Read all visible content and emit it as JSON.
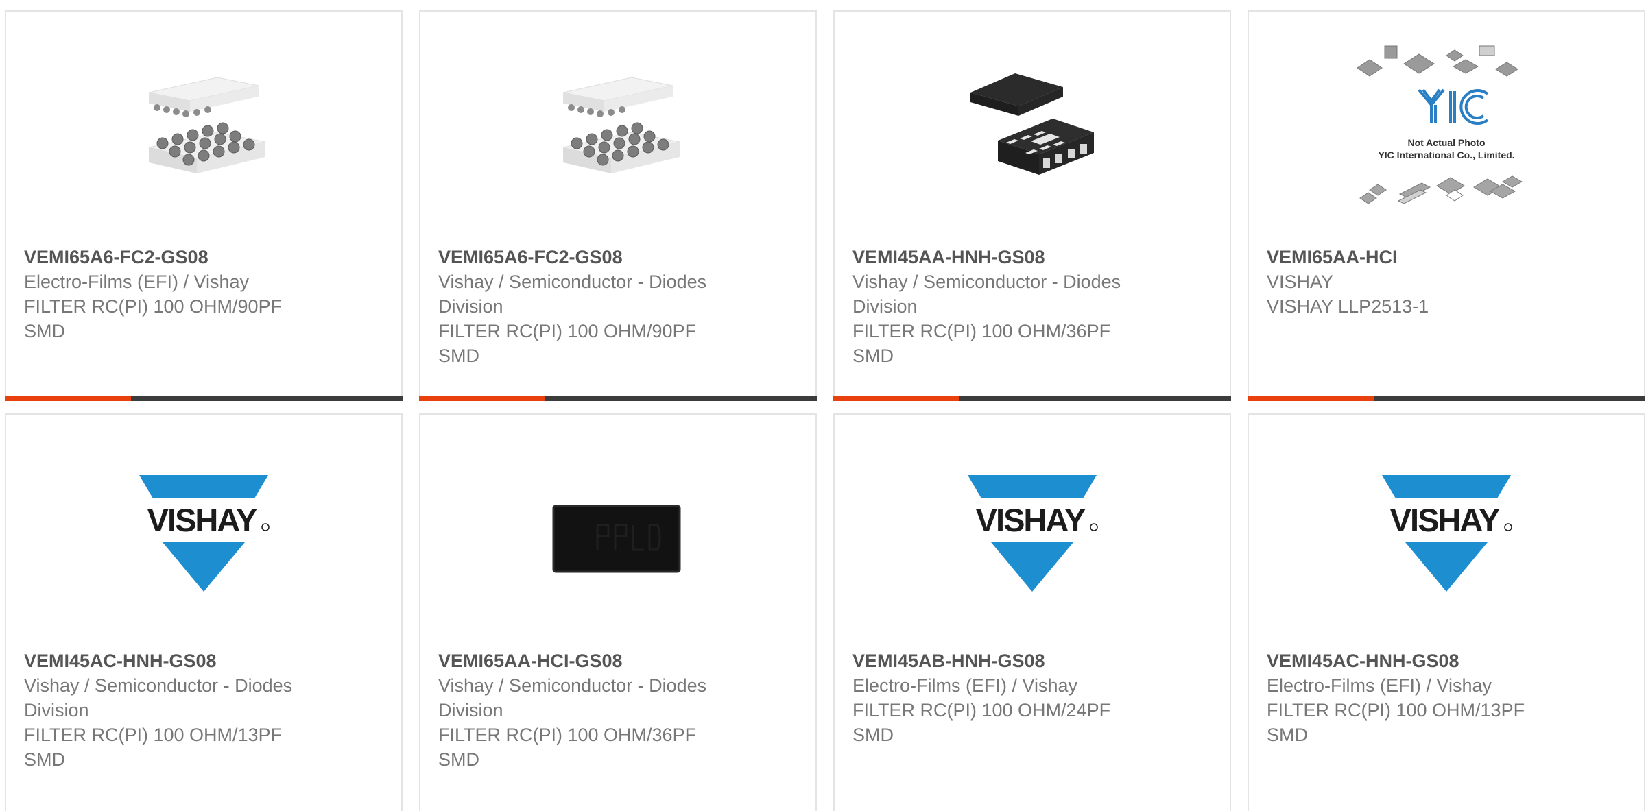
{
  "products": [
    {
      "part_number": "VEMI65A6-FC2-GS08",
      "lines": [
        "Electro-Films (EFI) / Vishay",
        "FILTER RC(PI) 100 OHM/90PF",
        "SMD"
      ],
      "image": "bga-package-icon",
      "show_bar": true
    },
    {
      "part_number": "VEMI65A6-FC2-GS08",
      "lines": [
        "Vishay / Semiconductor - Diodes",
        "Division",
        "FILTER RC(PI) 100 OHM/90PF",
        "SMD"
      ],
      "image": "bga-package-icon",
      "show_bar": true
    },
    {
      "part_number": "VEMI45AA-HNH-GS08",
      "lines": [
        "Vishay / Semiconductor - Diodes",
        "Division",
        "FILTER RC(PI) 100 OHM/36PF",
        "SMD"
      ],
      "image": "dfn-package-icon",
      "show_bar": true
    },
    {
      "part_number": "VEMI65AA-HCI",
      "lines": [
        "VISHAY",
        "VISHAY LLP2513-1"
      ],
      "image": "not-actual-photo",
      "show_bar": true
    },
    {
      "part_number": "VEMI45AC-HNH-GS08",
      "lines": [
        "Vishay / Semiconductor - Diodes",
        "Division",
        "FILTER RC(PI) 100 OHM/13PF",
        "SMD"
      ],
      "image": "vishay-logo",
      "show_bar": false
    },
    {
      "part_number": "VEMI65AA-HCI-GS08",
      "lines": [
        "Vishay / Semiconductor - Diodes",
        "Division",
        "FILTER RC(PI) 100 OHM/36PF",
        "SMD"
      ],
      "image": "chip-photo",
      "show_bar": false
    },
    {
      "part_number": "VEMI45AB-HNH-GS08",
      "lines": [
        "Electro-Films (EFI) / Vishay",
        "FILTER RC(PI) 100 OHM/24PF",
        "SMD"
      ],
      "image": "vishay-logo",
      "show_bar": false
    },
    {
      "part_number": "VEMI45AC-HNH-GS08",
      "lines": [
        "Electro-Films (EFI) / Vishay",
        "FILTER RC(PI) 100 OHM/13PF",
        "SMD"
      ],
      "image": "vishay-logo",
      "show_bar": false
    }
  ],
  "logo_text": {
    "vishay": "VISHAY",
    "yic_caption_1": "Not Actual Photo",
    "yic_caption_2": "YIC International Co., Limited."
  },
  "colors": {
    "accent": "#e8410e",
    "bar": "#3c3c3c",
    "vishay_blue": "#1d8ed0"
  }
}
